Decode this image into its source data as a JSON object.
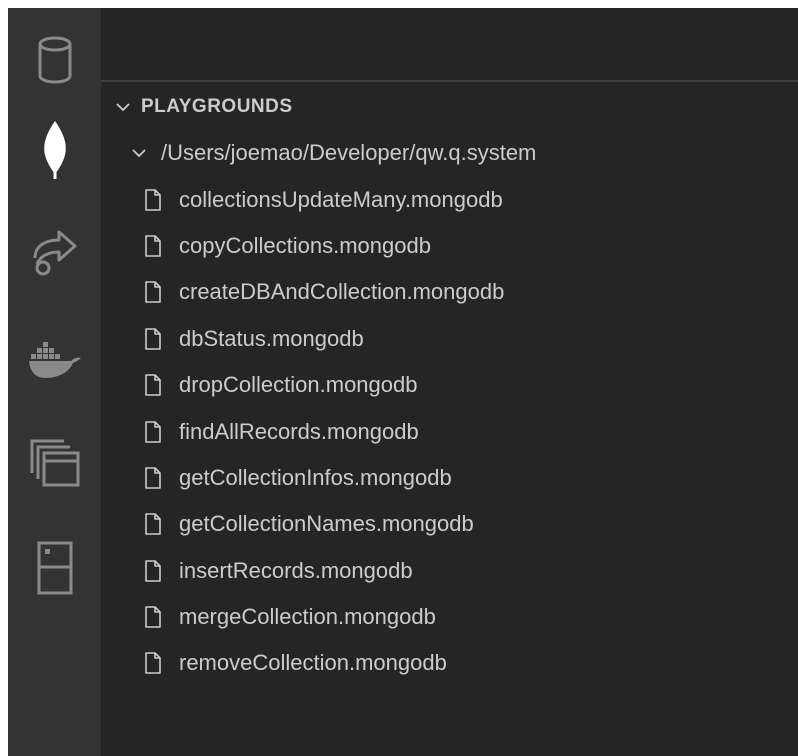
{
  "activity_bar": {
    "items": [
      {
        "icon": "database-icon"
      },
      {
        "icon": "mongodb-leaf-icon"
      },
      {
        "icon": "remote-share-icon"
      },
      {
        "icon": "docker-icon"
      },
      {
        "icon": "stacked-windows-icon"
      },
      {
        "icon": "device-icon"
      }
    ]
  },
  "playgrounds": {
    "section_title": "PLAYGROUNDS",
    "folder": "/Users/joemao/Developer/qw.q.system",
    "files": [
      "collectionsUpdateMany.mongodb",
      "copyCollections.mongodb",
      "createDBAndCollection.mongodb",
      "dbStatus.mongodb",
      "dropCollection.mongodb",
      "findAllRecords.mongodb",
      "getCollectionInfos.mongodb",
      "getCollectionNames.mongodb",
      "insertRecords.mongodb",
      "mergeCollection.mongodb",
      "removeCollection.mongodb"
    ]
  },
  "colors": {
    "activity_bar": "#333333",
    "side_bar": "#252526",
    "text": "#cccccc",
    "icon_inactive": "#8a8a8a",
    "icon_active": "#ffffff"
  }
}
